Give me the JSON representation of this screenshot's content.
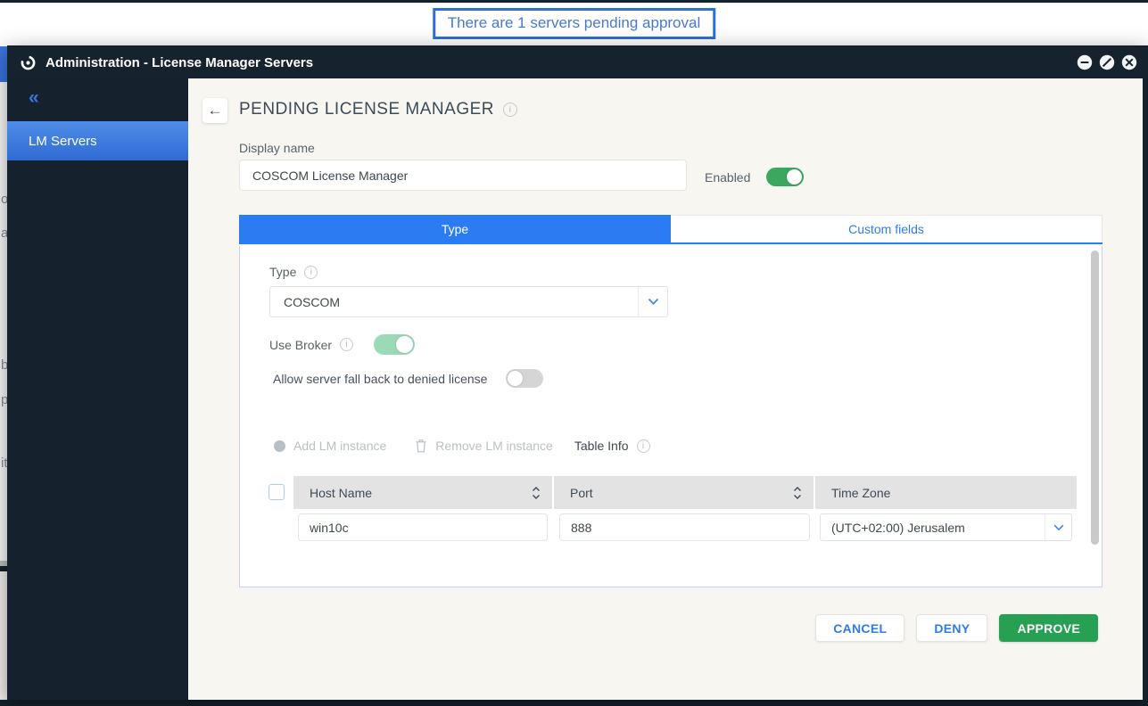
{
  "colors": {
    "accent_blue": "#2b7cf3",
    "dark_navy": "#15222e",
    "approve_green": "#27a053",
    "enabled_toggle_green": "#3aa85f",
    "broker_toggle_pastel_green": "#9cd9b6",
    "main_background_beige": "#f8f6f1"
  },
  "banner": {
    "text": "There are 1 servers pending approval"
  },
  "window": {
    "title": "Administration - License Manager Servers"
  },
  "sidebar": {
    "collapse_icon": "«",
    "items": [
      {
        "label": "LM Servers",
        "active": true
      }
    ]
  },
  "icons": {
    "info": "i",
    "back": "←"
  },
  "page": {
    "title": "PENDING LICENSE MANAGER",
    "display_name_label": "Display name",
    "display_name_value": "COSCOM License Manager",
    "enabled_label": "Enabled",
    "enabled_state": "on",
    "tabs": [
      {
        "label": "Type",
        "active": true
      },
      {
        "label": "Custom fields",
        "active": false
      }
    ],
    "type_label": "Type",
    "type_value": "COSCOM",
    "use_broker_label": "Use Broker",
    "use_broker_state": "on",
    "fallback_label": "Allow server fall back to denied license",
    "fallback_state": "off",
    "toolbar": {
      "add_label": "Add LM instance",
      "remove_label": "Remove LM instance",
      "table_info_label": "Table Info"
    },
    "table": {
      "columns": [
        "Host Name",
        "Port",
        "Time Zone"
      ],
      "rows": [
        {
          "host_name": "win10c",
          "port": "888",
          "time_zone": "(UTC+02:00) Jerusalem"
        }
      ]
    },
    "actions": {
      "cancel": "CANCEL",
      "deny": "DENY",
      "approve": "APPROVE"
    }
  },
  "background_fragments": [
    "o",
    "a",
    "b",
    "p",
    "it"
  ]
}
